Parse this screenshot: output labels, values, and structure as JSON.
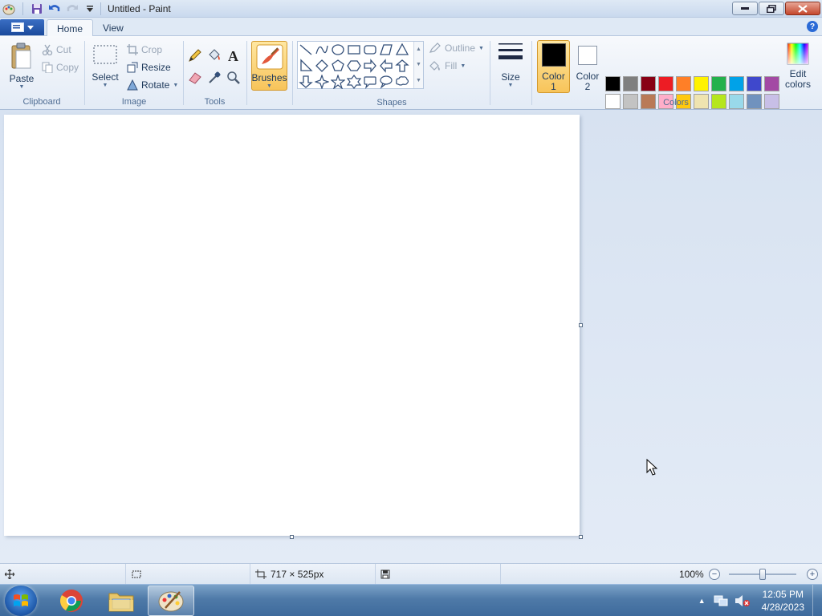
{
  "window": {
    "title": "Untitled - Paint"
  },
  "tabs": [
    {
      "label": "Home"
    },
    {
      "label": "View"
    }
  ],
  "clipboard": {
    "group_label": "Clipboard",
    "paste": "Paste",
    "cut": "Cut",
    "copy": "Copy"
  },
  "image": {
    "group_label": "Image",
    "select": "Select",
    "crop": "Crop",
    "resize": "Resize",
    "rotate": "Rotate"
  },
  "tools": {
    "group_label": "Tools"
  },
  "brushes": {
    "label": "Brushes"
  },
  "shapes": {
    "group_label": "Shapes",
    "outline": "Outline",
    "fill": "Fill"
  },
  "size": {
    "label": "Size"
  },
  "colors": {
    "group_label": "Colors",
    "color1_line1": "Color",
    "color1_line2": "1",
    "color2_line1": "Color",
    "color2_line2": "2",
    "edit_line1": "Edit",
    "edit_line2": "colors",
    "color1_value": "#000000",
    "color2_value": "#ffffff",
    "row1": [
      "#000000",
      "#7f7f7f",
      "#880015",
      "#ed1c24",
      "#ff7f27",
      "#fff200",
      "#22b14c",
      "#00a2e8",
      "#3f48cc",
      "#a349a4"
    ],
    "row2": [
      "#ffffff",
      "#c3c3c3",
      "#b97a57",
      "#ffaec9",
      "#ffc90e",
      "#efe4b0",
      "#b5e61d",
      "#99d9ea",
      "#7092be",
      "#c8bfe7"
    ]
  },
  "status": {
    "dimensions": "717 × 525px",
    "zoom": "100%"
  },
  "taskbar": {
    "time": "12:05 PM",
    "date": "4/28/2023"
  }
}
